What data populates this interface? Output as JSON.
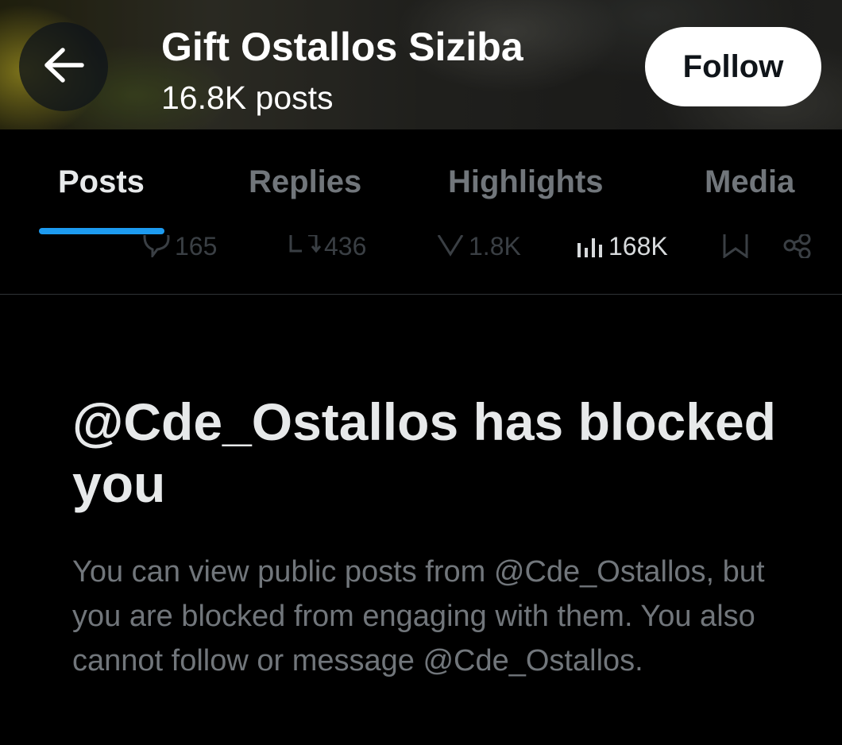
{
  "header": {
    "profile_name": "Gift Ostallos Siziba",
    "post_count": "16.8K posts",
    "follow_label": "Follow",
    "back_icon": "arrow-left-icon"
  },
  "tabs": [
    {
      "label": "Posts",
      "active": true
    },
    {
      "label": "Replies",
      "active": false
    },
    {
      "label": "Highlights",
      "active": false
    },
    {
      "label": "Media",
      "active": false
    }
  ],
  "actions": {
    "replies": "165",
    "reposts": "436",
    "likes": "1.8K",
    "views": "168K"
  },
  "blocked": {
    "title": "@Cde_Ostallos has blocked you",
    "body": "You can view public posts from @Cde_Ostallos, but you are blocked from engaging with them. You also cannot follow or message @Cde_Ostallos."
  },
  "colors": {
    "accent": "#1d9bf0",
    "background": "#000000",
    "text_primary": "#e7e9ea",
    "text_secondary": "#71767b"
  }
}
